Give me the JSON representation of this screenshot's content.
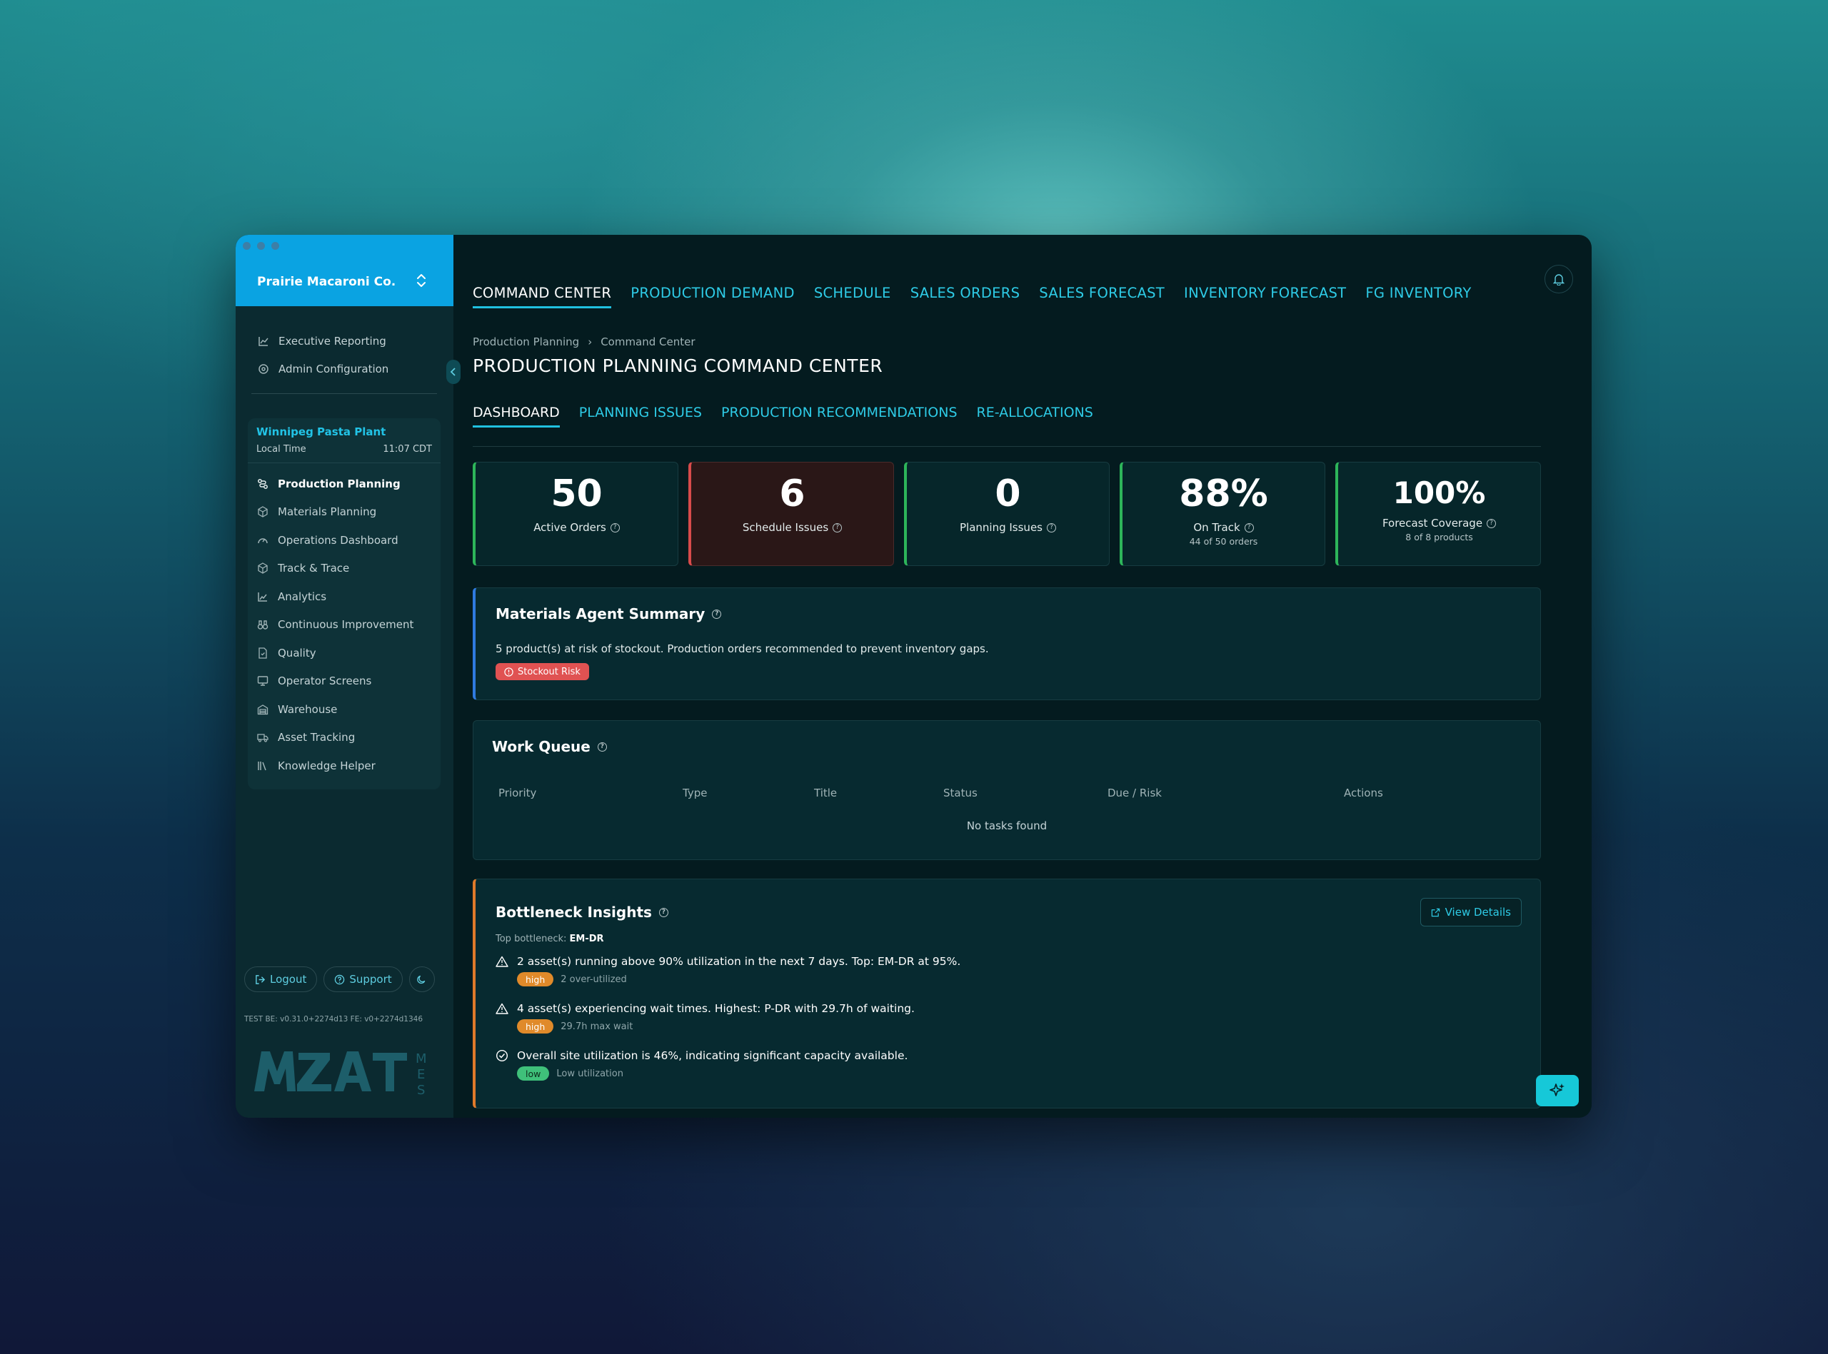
{
  "company": {
    "name": "Prairie Macaroni Co."
  },
  "nav_top": [
    {
      "label": "Executive Reporting",
      "icon": "chart-line-icon"
    },
    {
      "label": "Admin Configuration",
      "icon": "settings-icon"
    }
  ],
  "plant": {
    "name": "Winnipeg Pasta Plant",
    "local_time_label": "Local Time",
    "local_time": "11:07 CDT",
    "nav": [
      {
        "label": "Production Planning",
        "icon": "route-icon",
        "active": true
      },
      {
        "label": "Materials Planning",
        "icon": "box-icon"
      },
      {
        "label": "Operations Dashboard",
        "icon": "gauge-icon"
      },
      {
        "label": "Track & Trace",
        "icon": "package-icon"
      },
      {
        "label": "Analytics",
        "icon": "analytics-icon"
      },
      {
        "label": "Continuous Improvement",
        "icon": "binoculars-icon"
      },
      {
        "label": "Quality",
        "icon": "file-check-icon"
      },
      {
        "label": "Operator Screens",
        "icon": "monitor-icon"
      },
      {
        "label": "Warehouse",
        "icon": "warehouse-icon"
      },
      {
        "label": "Asset Tracking",
        "icon": "truck-icon"
      },
      {
        "label": "Knowledge Helper",
        "icon": "library-icon"
      }
    ]
  },
  "sidebar_footer": {
    "logout_label": "Logout",
    "support_label": "Support",
    "version": "TEST   BE: v0.31.0+2274d13   FE: v0+2274d1346"
  },
  "top_tabs": [
    {
      "label": "COMMAND CENTER",
      "active": true
    },
    {
      "label": "PRODUCTION DEMAND"
    },
    {
      "label": "SCHEDULE"
    },
    {
      "label": "SALES ORDERS"
    },
    {
      "label": "SALES FORECAST"
    },
    {
      "label": "INVENTORY FORECAST"
    },
    {
      "label": "FG INVENTORY"
    }
  ],
  "breadcrumb": {
    "parent": "Production Planning",
    "current": "Command Center"
  },
  "page_title": "PRODUCTION PLANNING COMMAND CENTER",
  "sub_tabs": [
    {
      "label": "DASHBOARD",
      "active": true
    },
    {
      "label": "PLANNING ISSUES"
    },
    {
      "label": "PRODUCTION RECOMMENDATIONS"
    },
    {
      "label": "RE-ALLOCATIONS"
    }
  ],
  "kpis": [
    {
      "value": "50",
      "label": "Active Orders",
      "sub": "",
      "tone": "green"
    },
    {
      "value": "6",
      "label": "Schedule Issues",
      "sub": "",
      "tone": "red"
    },
    {
      "value": "0",
      "label": "Planning Issues",
      "sub": "",
      "tone": "green"
    },
    {
      "value": "88%",
      "label": "On Track",
      "sub": "44 of 50 orders",
      "tone": "green"
    },
    {
      "value": "100%",
      "label": "Forecast Coverage",
      "sub": "8 of 8 products",
      "tone": "green"
    }
  ],
  "materials": {
    "title": "Materials Agent Summary",
    "text": "5 product(s) at risk of stockout. Production orders recommended to prevent inventory gaps.",
    "badge": "Stockout Risk"
  },
  "work_queue": {
    "title": "Work Queue",
    "columns": [
      "Priority",
      "Type",
      "Title",
      "Status",
      "Due / Risk",
      "Actions"
    ],
    "empty": "No tasks found"
  },
  "bottleneck": {
    "title": "Bottleneck Insights",
    "view_details": "View Details",
    "top_label": "Top bottleneck:",
    "top_value": "EM-DR",
    "insights": [
      {
        "icon": "warning-icon",
        "text": "2 asset(s) running above 90% utilization in the next 7 days. Top: EM-DR at 95%.",
        "level": "high",
        "meta": "2 over-utilized"
      },
      {
        "icon": "warning-icon",
        "text": "4 asset(s) experiencing wait times. Highest: P-DR with 29.7h of waiting.",
        "level": "high",
        "meta": "29.7h max wait"
      },
      {
        "icon": "check-circle-icon",
        "text": "Overall site utilization is 46%, indicating significant capacity available.",
        "level": "low",
        "meta": "Low utilization"
      }
    ]
  },
  "colors": {
    "accent": "#20c1e0",
    "company_bar": "#0aa3e2",
    "ok": "#2db55a",
    "danger": "#d84b4b",
    "warn": "#e07a2a"
  }
}
